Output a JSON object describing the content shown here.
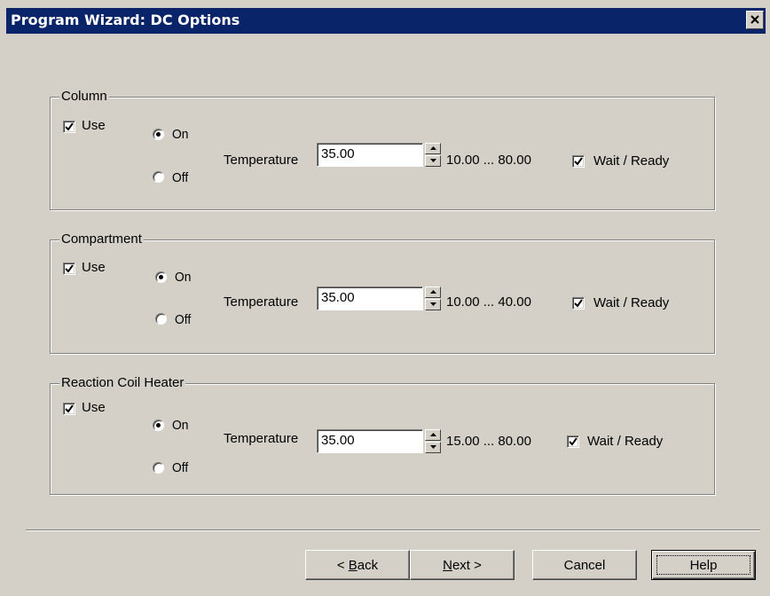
{
  "window": {
    "title": "Program Wizard: DC Options"
  },
  "groups": [
    {
      "title": "Column",
      "use_label": "Use",
      "use_checked": true,
      "on_label": "On",
      "off_label": "Off",
      "selected": "On",
      "temperature_label": "Temperature",
      "temperature_value": "35.00",
      "range": "10.00 ... 80.00",
      "wait_label": "Wait / Ready",
      "wait_checked": true
    },
    {
      "title": "Compartment",
      "use_label": "Use",
      "use_checked": true,
      "on_label": "On",
      "off_label": "Off",
      "selected": "On",
      "temperature_label": "Temperature",
      "temperature_value": "35.00",
      "range": "10.00 ... 40.00",
      "wait_label": "Wait / Ready",
      "wait_checked": true
    },
    {
      "title": "Reaction Coil Heater",
      "use_label": "Use",
      "use_checked": true,
      "on_label": "On",
      "off_label": "Off",
      "selected": "On",
      "temperature_label": "Temperature",
      "temperature_value": "35.00",
      "range": "15.00 ... 80.00",
      "wait_label": "Wait / Ready",
      "wait_checked": true
    }
  ],
  "buttons": {
    "back_prefix": "< ",
    "back_mnemonic": "B",
    "back_rest": "ack",
    "next_mnemonic": "N",
    "next_rest": "ext >",
    "cancel": "Cancel",
    "help": "Help"
  },
  "icons": {
    "close": "close-icon",
    "check": "check-icon",
    "spin_up": "spin-up-icon",
    "spin_down": "spin-down-icon"
  },
  "colors": {
    "titlebar": "#0a246a",
    "face": "#d4d0c8"
  }
}
